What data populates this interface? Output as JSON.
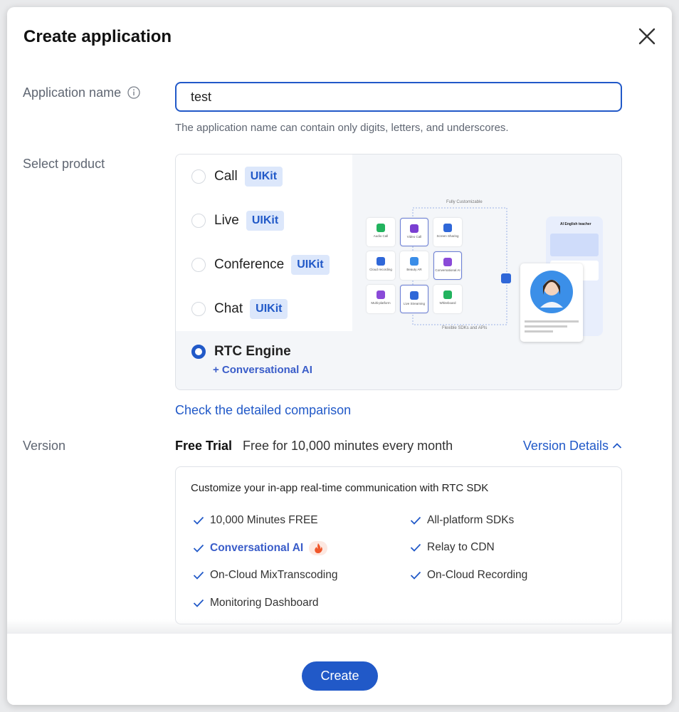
{
  "dialog": {
    "title": "Create application"
  },
  "app_name": {
    "label": "Application name",
    "value": "test",
    "hint": "The application name can contain only digits, letters, and underscores."
  },
  "product": {
    "label": "Select product",
    "options": [
      {
        "name": "Call",
        "tag": "UIKit",
        "selected": false
      },
      {
        "name": "Live",
        "tag": "UIKit",
        "selected": false
      },
      {
        "name": "Conference",
        "tag": "UIKit",
        "selected": false
      },
      {
        "name": "Chat",
        "tag": "UIKit",
        "selected": false
      },
      {
        "name": "RTC Engine",
        "tag": "",
        "selected": true
      }
    ],
    "rtc_sub": "+ Conversational AI",
    "illustration": {
      "title": "Fully Customizable",
      "footer": "Flexible SDKs and APIs",
      "tiles": [
        "Audio Call",
        "Video Call",
        "Screen Sharing",
        "Cloud recording",
        "Beauty AR",
        "Conversational AI",
        "Multi-platform",
        "Live Streaming",
        "Whiteboard"
      ],
      "phone_title": "AI English teacher"
    },
    "compare_link": "Check the detailed comparison"
  },
  "version": {
    "label": "Version",
    "name": "Free Trial",
    "desc": "Free for 10,000 minutes every month",
    "details_link": "Version Details",
    "features_heading": "Customize your in-app real-time communication with RTC SDK",
    "features": [
      "10,000 Minutes FREE",
      "All-platform SDKs",
      "Conversational AI",
      "Relay to CDN",
      "On-Cloud MixTranscoding",
      "On-Cloud Recording",
      "Monitoring Dashboard"
    ]
  },
  "footer": {
    "create_label": "Create"
  },
  "colors": {
    "accent": "#2159c8",
    "tag_bg": "#dce7fb",
    "ai_text": "#3a5dc9"
  }
}
